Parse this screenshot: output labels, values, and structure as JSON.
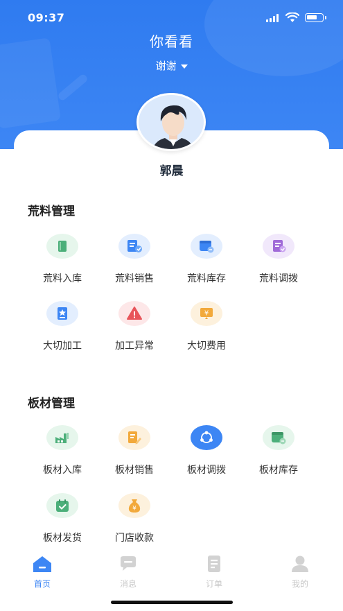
{
  "status": {
    "time": "09:37"
  },
  "header": {
    "title": "你看看",
    "subtitle": "谢谢"
  },
  "profile": {
    "name": "郭晨"
  },
  "sections": [
    {
      "title": "荒料管理",
      "items": [
        {
          "label": "荒料入库",
          "icon": "book-icon",
          "color": "#4caf7a",
          "bg": "#e6f6ec"
        },
        {
          "label": "荒料销售",
          "icon": "sales-report-icon",
          "color": "#3d86f4",
          "bg": "#e3eefe"
        },
        {
          "label": "荒料库存",
          "icon": "inventory-icon",
          "color": "#3d86f4",
          "bg": "#e3eefe"
        },
        {
          "label": "荒料调拨",
          "icon": "transfer-doc-icon",
          "color": "#a06ad8",
          "bg": "#f1e8fb"
        },
        {
          "label": "大切加工",
          "icon": "star-doc-icon",
          "color": "#3d86f4",
          "bg": "#e3eefe"
        },
        {
          "label": "加工异常",
          "icon": "warning-icon",
          "color": "#e8545a",
          "bg": "#fde7e8"
        },
        {
          "label": "大切费用",
          "icon": "yen-icon",
          "color": "#f2a93b",
          "bg": "#fdf1dd"
        }
      ]
    },
    {
      "title": "板材管理",
      "items": [
        {
          "label": "板材入库",
          "icon": "factory-icon",
          "color": "#4caf7a",
          "bg": "#e6f6ec"
        },
        {
          "label": "板材销售",
          "icon": "sales-edit-icon",
          "color": "#f2a93b",
          "bg": "#fdf1dd"
        },
        {
          "label": "板材调拨",
          "icon": "share-circle-icon",
          "color": "#ffffff",
          "bg": "#3d86f4"
        },
        {
          "label": "板材库存",
          "icon": "inventory-icon",
          "color": "#4caf7a",
          "bg": "#e6f6ec"
        },
        {
          "label": "板材发货",
          "icon": "calendar-check-icon",
          "color": "#4caf7a",
          "bg": "#e6f6ec"
        },
        {
          "label": "门店收款",
          "icon": "money-bag-icon",
          "color": "#f2a93b",
          "bg": "#fdf1dd"
        }
      ]
    }
  ],
  "tabbar": [
    {
      "label": "首页",
      "icon": "home-icon",
      "active": true
    },
    {
      "label": "消息",
      "icon": "message-icon",
      "active": false
    },
    {
      "label": "订单",
      "icon": "order-icon",
      "active": false
    },
    {
      "label": "我的",
      "icon": "user-icon",
      "active": false
    }
  ],
  "colors": {
    "primary": "#3d86f4",
    "inactive": "#c8c8c8"
  }
}
